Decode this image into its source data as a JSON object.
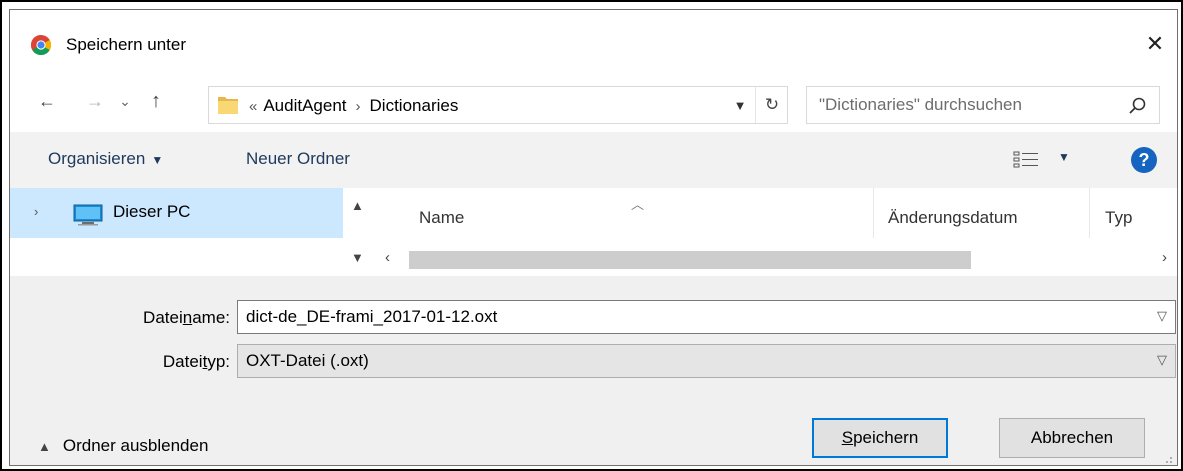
{
  "dialog": {
    "title": "Speichern unter",
    "close_glyph": "✕"
  },
  "nav": {
    "back_glyph": "←",
    "forward_glyph": "→",
    "recent_glyph": "⌄",
    "up_glyph": "↑",
    "breadcrumb_prefix": "«",
    "breadcrumb": [
      "AuditAgent",
      "Dictionaries"
    ],
    "breadcrumb_separator": "›",
    "refresh_glyph": "↻",
    "search_placeholder": "\"Dictionaries\" durchsuchen"
  },
  "toolbar": {
    "organize_label": "Organisieren",
    "new_folder_label": "Neuer Ordner",
    "help_glyph": "?"
  },
  "tree": {
    "items": [
      {
        "label": "Dieser PC",
        "selected": true
      }
    ]
  },
  "file_list": {
    "columns": [
      "Name",
      "Änderungsdatum",
      "Typ"
    ]
  },
  "form": {
    "filename_label_pre": "Datei",
    "filename_label_accel": "n",
    "filename_label_post": "ame:",
    "filename_value": "dict-de_DE-frami_2017-01-12.oxt",
    "filetype_label_pre": "Datei",
    "filetype_label_accel": "t",
    "filetype_label_post": "yp:",
    "filetype_value": "OXT-Datei (.oxt)"
  },
  "footer": {
    "hide_folders_label": "Ordner ausblenden",
    "save_label_accel": "S",
    "save_label_rest": "peichern",
    "cancel_label": "Abbrechen"
  },
  "colors": {
    "selection": "#cce8ff",
    "accent": "#0078d7",
    "help": "#1565c0",
    "toolbar_text": "#1e395b"
  }
}
